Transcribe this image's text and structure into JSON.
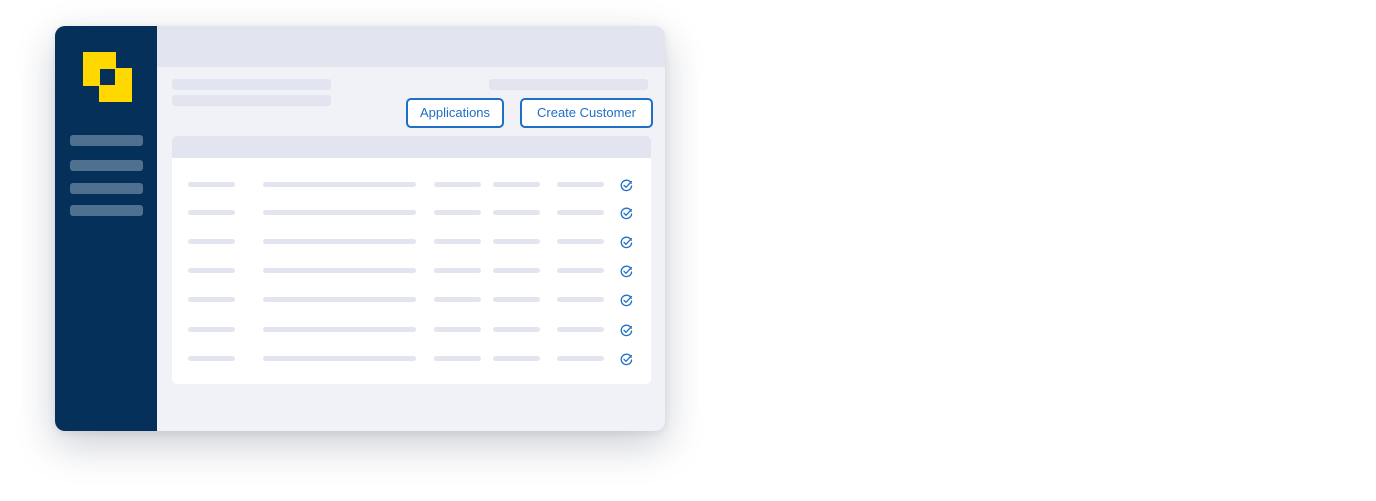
{
  "toolbar": {
    "applications_label": "Applications",
    "create_customer_label": "Create Customer"
  },
  "sidebar": {
    "logo_icon": "brand-logo-icon",
    "nav_items": 4
  },
  "table": {
    "row_count": 7,
    "row_icon": "check-circle-icon"
  },
  "colors": {
    "sidebar": "#04305a",
    "logo": "#ffd800",
    "accent": "#1f6fc4",
    "placeholder": "#e2e5ef",
    "content_bg": "#f0f2f7"
  }
}
